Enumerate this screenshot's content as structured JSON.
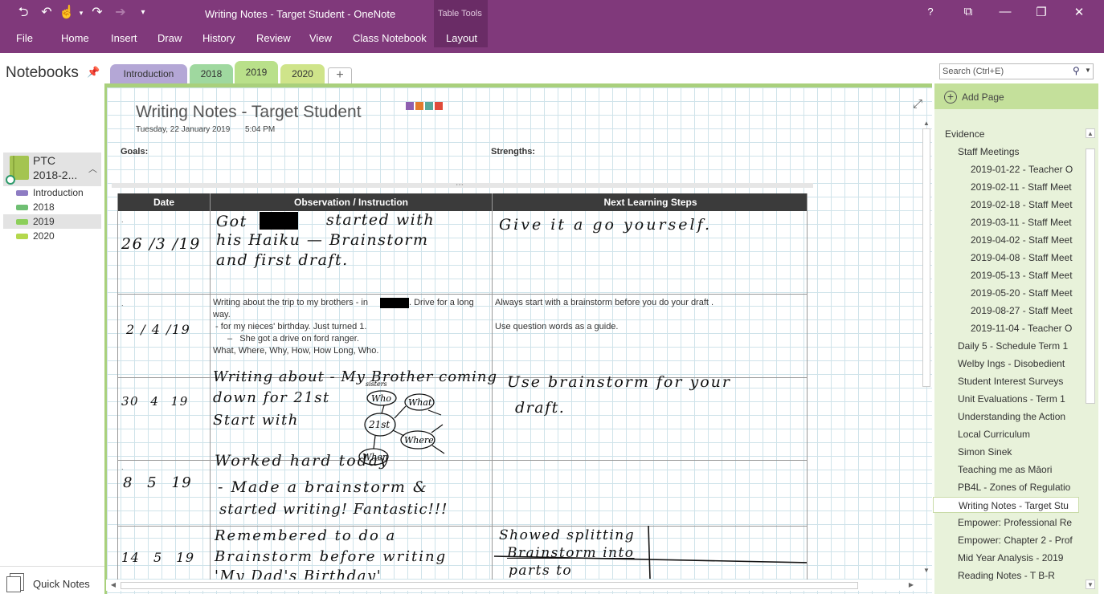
{
  "window": {
    "title": "Writing Notes - Target Student - OneNote",
    "context_tab_group": "Table Tools",
    "controls": {
      "help": "?"
    }
  },
  "ribbon": {
    "tabs": [
      "File",
      "Home",
      "Insert",
      "Draw",
      "History",
      "Review",
      "View",
      "Class Notebook",
      "Layout"
    ],
    "active_tab": "Layout"
  },
  "notebooks": {
    "header": "Notebooks",
    "current": {
      "name_line1": "PTC",
      "name_line2": "2018-2..."
    },
    "sections": [
      {
        "label": "Introduction",
        "color": "#8e7cc3"
      },
      {
        "label": "2018",
        "color": "#6fbf73"
      },
      {
        "label": "2019",
        "color": "#8ccf5a"
      },
      {
        "label": "2020",
        "color": "#b4d84d"
      }
    ],
    "selected_section": "2019",
    "quick_notes": "Quick Notes"
  },
  "section_tabs": [
    {
      "label": "Introduction",
      "color": "#b4a7d6"
    },
    {
      "label": "2018",
      "color": "#9fd89f"
    },
    {
      "label": "2019",
      "color": "#b9e08a"
    },
    {
      "label": "2020",
      "color": "#cfe48a"
    }
  ],
  "add_tab_glyph": "+",
  "page": {
    "title": "Writing Notes - Target Student",
    "date": "Tuesday, 22 January 2019",
    "time": "5:04 PM",
    "tag_colors": [
      "#8e5fb0",
      "#e37b2c",
      "#56a89a",
      "#e04b3a"
    ],
    "goals_label": "Goals:",
    "strengths_label": "Strengths:",
    "table": {
      "headers": [
        "Date",
        "Observation / Instruction",
        "Next Learning Steps"
      ],
      "rows": [
        {
          "date_handwritten": "26 /3 /19",
          "observation_handwritten": [
            "Got",
            "started with",
            "his Haiku — Brainstorm",
            "and first draft."
          ],
          "next_steps_handwritten": "Give it a go yourself."
        },
        {
          "date_handwritten": "2 / 4 /19",
          "observation_typed": [
            "Writing about the trip to my brothers - in",
            ". Drive for a long",
            "way.",
            " - for my nieces' birthday. Just turned 1.",
            "–   She got a drive on ford ranger.",
            "What, Where, Why, How, How Long, Who."
          ],
          "next_steps_typed": [
            "Always start with a brainstorm before you do your draft .",
            "Use question words as a guide."
          ]
        },
        {
          "date_handwritten": "30  4  19",
          "observation_handwritten": [
            "Writing about - My Brother coming",
            "down for 21st",
            "Start with"
          ],
          "brainstorm_handwritten": [
            "sisters",
            "Who",
            "What",
            "21st",
            "Where",
            "When"
          ],
          "next_steps_handwritten": [
            "Use brainstorm for your",
            "draft."
          ]
        },
        {
          "date_handwritten": "8  5  19",
          "observation_handwritten": [
            "Worked hard today",
            "- Made a brainstorm &",
            "started writing! Fantastic!!!"
          ]
        },
        {
          "date_handwritten": "14  5  19",
          "observation_handwritten": [
            "Remembered to do a",
            "Brainstorm before writing",
            "'My Dad's Birthday'"
          ],
          "next_steps_handwritten": [
            "Showed splitting",
            "Brainstorm into",
            "parts  to"
          ]
        }
      ]
    }
  },
  "search": {
    "placeholder": "Search (Ctrl+E)"
  },
  "page_list": {
    "add_page": "Add Page",
    "items": [
      {
        "label": "Evidence",
        "level": 0
      },
      {
        "label": "Staff Meetings",
        "level": 1
      },
      {
        "label": "2019-01-22 - Teacher O",
        "level": 2
      },
      {
        "label": "2019-02-11 - Staff Meet",
        "level": 2
      },
      {
        "label": "2019-02-18 - Staff Meet",
        "level": 2
      },
      {
        "label": "2019-03-11 - Staff Meet",
        "level": 2
      },
      {
        "label": "2019-04-02 - Staff Meet",
        "level": 2
      },
      {
        "label": "2019-04-08 - Staff Meet",
        "level": 2
      },
      {
        "label": "2019-05-13 - Staff Meet",
        "level": 2
      },
      {
        "label": "2019-05-20 - Staff Meet",
        "level": 2
      },
      {
        "label": "2019-08-27 - Staff Meet",
        "level": 2
      },
      {
        "label": "2019-11-04 - Teacher O",
        "level": 2
      },
      {
        "label": "Daily 5 - Schedule Term 1",
        "level": 1
      },
      {
        "label": "Welby Ings - Disobedient",
        "level": 1
      },
      {
        "label": "Student Interest Surveys",
        "level": 1
      },
      {
        "label": "Unit Evaluations - Term 1",
        "level": 1
      },
      {
        "label": "Understanding the Action",
        "level": 1
      },
      {
        "label": "Local Curriculum",
        "level": 1
      },
      {
        "label": "Simon Sinek",
        "level": 1
      },
      {
        "label": "Teaching me as Māori",
        "level": 1
      },
      {
        "label": "PB4L - Zones of Regulatio",
        "level": 1
      },
      {
        "label": "Writing Notes - Target Stu",
        "level": 1
      },
      {
        "label": "Empower: Professional Re",
        "level": 1
      },
      {
        "label": "Empower: Chapter 2 - Prof",
        "level": 1
      },
      {
        "label": "Mid Year Analysis - 2019",
        "level": 1
      },
      {
        "label": "Reading Notes - T B-R",
        "level": 1
      }
    ],
    "selected": "Writing Notes - Target Stu"
  }
}
